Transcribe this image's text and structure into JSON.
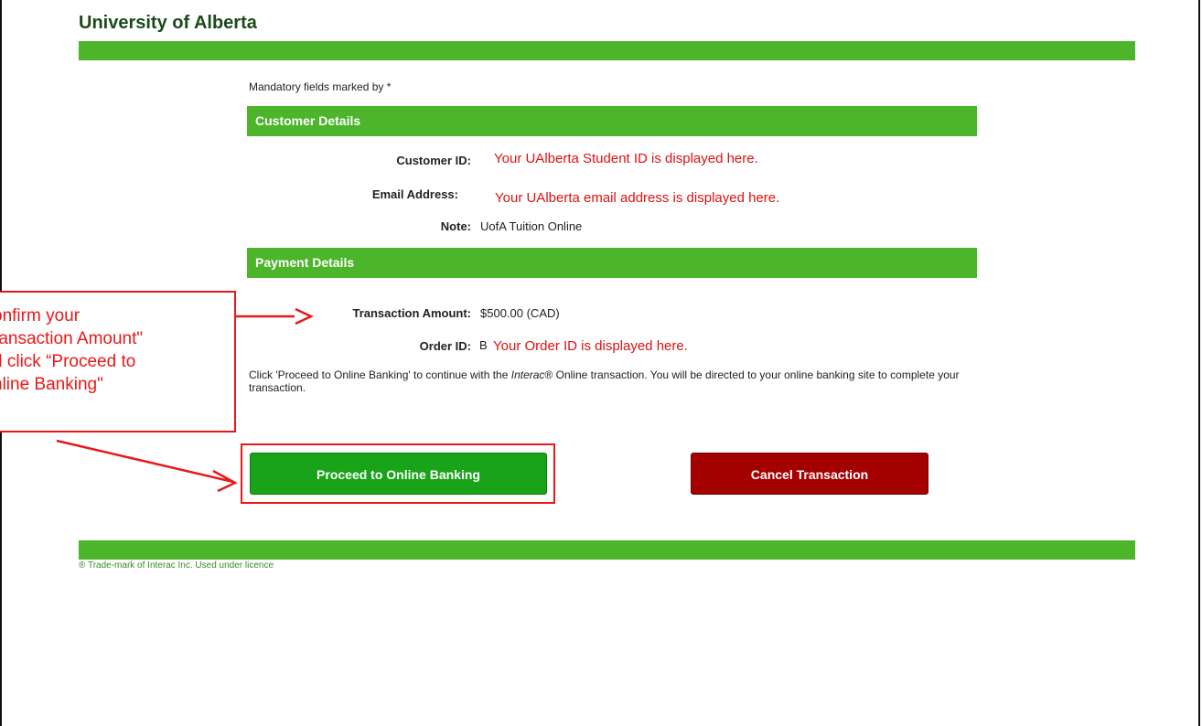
{
  "header": {
    "title": "University of Alberta"
  },
  "form": {
    "mandatory_note": "Mandatory fields marked by *"
  },
  "customer": {
    "section_title": "Customer Details",
    "customer_id_label": "Customer ID:",
    "customer_id_note": "Your UAlberta Student ID is displayed here.",
    "email_label": "Email Address:",
    "email_note": "Your UAlberta email address is displayed here.",
    "note_label": "Note:",
    "note_value": "UofA Tuition Online"
  },
  "payment": {
    "section_title": "Payment Details",
    "amount_label": "Transaction Amount:",
    "amount_value": "$500.00 (CAD)",
    "order_label": "Order ID:",
    "order_prefix": "B",
    "order_note": "Your Order ID is displayed here.",
    "description_pre": "Click 'Proceed to Online Banking' to continue with the ",
    "description_brand": "Interac",
    "description_post": "® Online transaction. You will be directed to your online banking site to complete your transaction."
  },
  "actions": {
    "proceed_label": "Proceed to Online Banking",
    "cancel_label": "Cancel Transaction"
  },
  "footer": {
    "trademark": "® Trade-mark of Interac Inc. Used under licence"
  },
  "callout": {
    "text": "onfirm your\nransaction Amount\"\nd click “Proceed to\nnline Banking\""
  },
  "colors": {
    "accent_green": "#4cb52a",
    "proceed_green": "#18a318",
    "cancel_red": "#a40000",
    "annotation_red": "#e81818"
  }
}
